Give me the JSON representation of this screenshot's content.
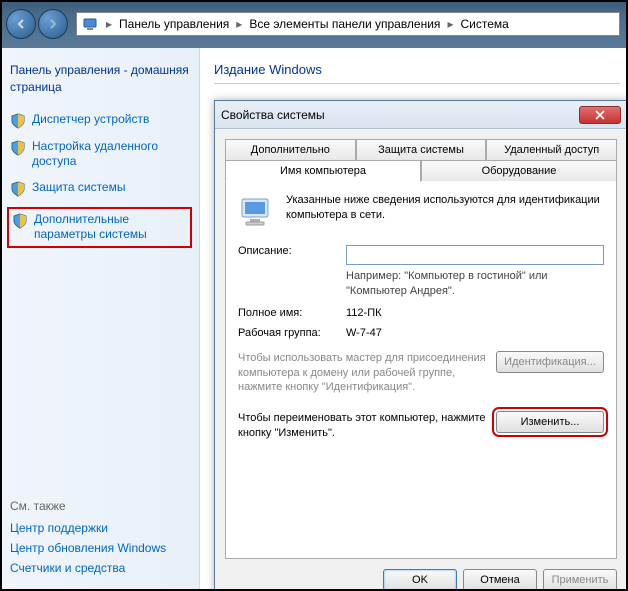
{
  "address_bar": {
    "seg1": "Панель управления",
    "seg2": "Все элементы панели управления",
    "seg3": "Система"
  },
  "sidebar": {
    "home": "Панель управления - домашняя страница",
    "items": [
      {
        "label": "Диспетчер устройств"
      },
      {
        "label": "Настройка удаленного доступа"
      },
      {
        "label": "Защита системы"
      },
      {
        "label": "Дополнительные параметры системы"
      }
    ],
    "see_also": "См. также",
    "footer": [
      "Центр поддержки",
      "Центр обновления Windows",
      "Счетчики и средства"
    ]
  },
  "content": {
    "title": "Издание Windows"
  },
  "dialog": {
    "title": "Свойства системы",
    "tabs_row1": [
      "Дополнительно",
      "Защита системы",
      "Удаленный доступ"
    ],
    "tabs_row2": [
      "Имя компьютера",
      "Оборудование"
    ],
    "intro": "Указанные ниже сведения используются для идентификации компьютера в сети.",
    "desc_label": "Описание:",
    "desc_value": "",
    "desc_hint": "Например: \"Компьютер в гостиной\" или \"Компьютер Андрея\".",
    "fullname_label": "Полное имя:",
    "fullname_value": "112-ПК",
    "workgroup_label": "Рабочая группа:",
    "workgroup_value": "W-7-47",
    "ident_text": "Чтобы использовать мастер для присоединения компьютера к домену или рабочей группе, нажмите кнопку \"Идентификация\".",
    "ident_button": "Идентификация...",
    "change_text": "Чтобы переименовать этот компьютер, нажмите кнопку \"Изменить\".",
    "change_button": "Изменить...",
    "ok": "OK",
    "cancel": "Отмена",
    "apply": "Применить"
  }
}
